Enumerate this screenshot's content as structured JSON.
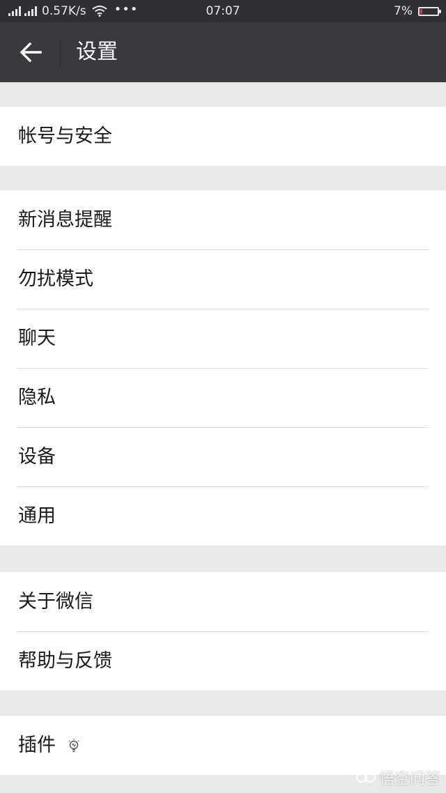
{
  "status_bar": {
    "network_speed": "0.57K/s",
    "overflow_dots": "•••",
    "time": "07:07",
    "battery_percent": "7%",
    "battery_level": 0.07,
    "battery_color": "#e53935"
  },
  "header": {
    "title": "设置",
    "back_icon": "arrow-left-icon"
  },
  "groups": [
    {
      "items": [
        {
          "label": "帐号与安全"
        }
      ]
    },
    {
      "items": [
        {
          "label": "新消息提醒"
        },
        {
          "label": "勿扰模式"
        },
        {
          "label": "聊天"
        },
        {
          "label": "隐私"
        },
        {
          "label": "设备"
        },
        {
          "label": "通用"
        }
      ]
    },
    {
      "items": [
        {
          "label": "关于微信"
        },
        {
          "label": "帮助与反馈"
        }
      ]
    },
    {
      "items": [
        {
          "label": "插件",
          "icon": "lightbulb-icon"
        }
      ]
    }
  ],
  "watermark": {
    "text": "悟空问答",
    "logo": "wukong-logo"
  }
}
